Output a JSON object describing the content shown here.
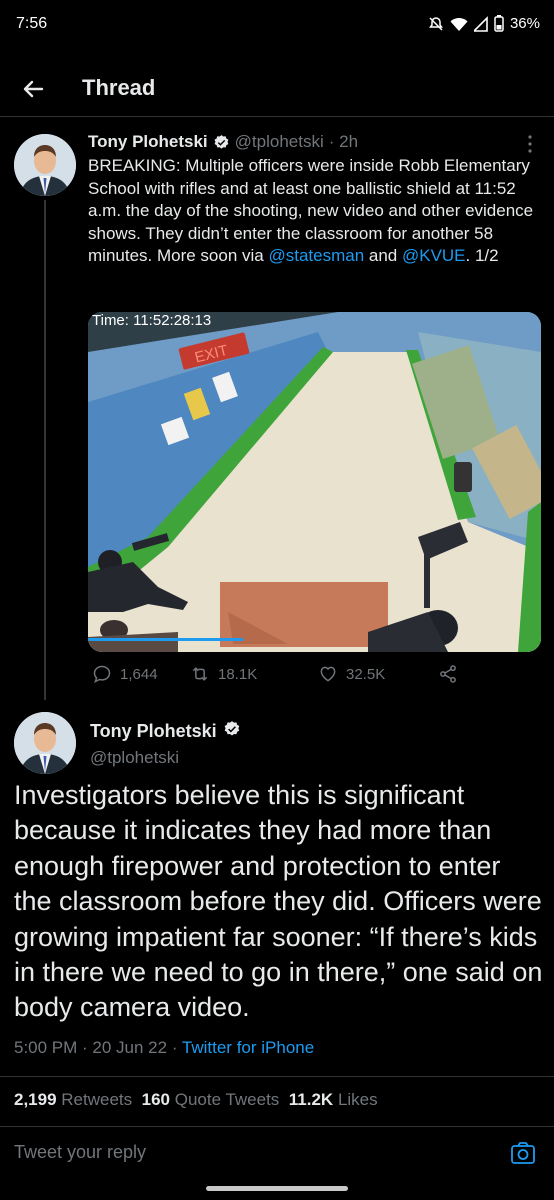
{
  "status_bar": {
    "time": "7:56",
    "battery": "36%",
    "icons": [
      "mute-icon",
      "wifi-icon",
      "signal-icon",
      "battery-icon"
    ]
  },
  "header": {
    "title": "Thread",
    "back_icon": "arrow-left-icon"
  },
  "tweet1": {
    "name": "Tony Plohetski",
    "handle": "@tplohetski",
    "time": "· 2h",
    "text_before": "BREAKING: Multiple officers were inside Robb Elementary School with rifles and at least one ballistic shield at 11:52 a.m. the day of the shooting, new video and other evidence shows. They didn’t enter the classroom for another 58 minutes. More soon via ",
    "mention1": "@statesman",
    "text_mid": " and ",
    "mention2": "@KVUE",
    "text_after": ". 1/2",
    "media_time": "Time: 11:52:28:13",
    "media_exit": "EXIT",
    "replies": "1,644",
    "retweets": "18.1K",
    "likes": "32.5K"
  },
  "tweet2": {
    "name": "Tony Plohetski",
    "handle": "@tplohetski",
    "text": "Investigators believe this is significant because it indicates they had more than enough firepower and protection to enter the classroom before they did. Officers were growing impatient far sooner: “If there’s kids in there we need to go in there,” one said on body camera video.",
    "time": "5:00 PM · 20 Jun 22 · ",
    "source": "Twitter for iPhone",
    "retweets_count": "2,199",
    "retweets_label": "Retweets",
    "quotes_count": "160",
    "quotes_label": "Quote Tweets",
    "likes_count": "11.2K",
    "likes_label": "Likes"
  },
  "reply": {
    "placeholder": "Tweet your reply",
    "camera_icon": "camera-icon"
  },
  "colors": {
    "background": "#000000",
    "text": "#e7e9ea",
    "secondary": "#71767b",
    "link": "#1d9bf0",
    "verified": "#e7e9ea"
  }
}
